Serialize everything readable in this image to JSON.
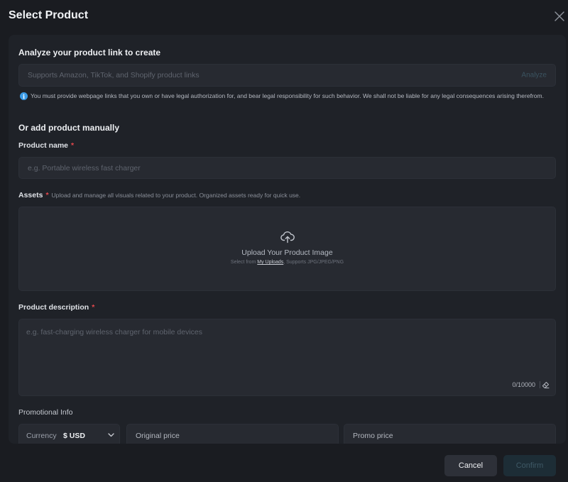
{
  "dialog": {
    "title": "Select Product"
  },
  "analyze": {
    "title": "Analyze your product link to create",
    "placeholder": "Supports Amazon, TikTok, and Shopify product links",
    "button_label": "Analyze",
    "notice": "You must provide webpage links that you own or have legal authorization for, and bear legal responsibility for such behavior. We shall not be liable for any legal consequences arising therefrom."
  },
  "manual": {
    "title": "Or add product manually",
    "required_mark": "*",
    "product_name": {
      "label": "Product name",
      "placeholder": "e.g. Portable wireless fast charger"
    },
    "assets": {
      "label": "Assets",
      "hint": "Upload and manage all visuals related to your product. Organized assets ready for quick use.",
      "upload_title": "Upload Your Product Image",
      "upload_sub_prefix": "Select from",
      "upload_sub_link": "My Uploads",
      "upload_sub_suffix": ", Supports JPG/JPEG/PNG"
    },
    "description": {
      "label": "Product description",
      "placeholder": "e.g. fast-charging wireless charger for mobile devices",
      "char_count": "0/10000"
    }
  },
  "promo": {
    "label": "Promotional Info",
    "currency_label": "Currency",
    "currency_value": "$ USD",
    "original_price_placeholder": "Original price",
    "promo_price_placeholder": "Promo price"
  },
  "footer": {
    "cancel_label": "Cancel",
    "confirm_label": "Confirm"
  },
  "colors": {
    "background": "#1a1c21",
    "panel": "#1f2228",
    "field": "#272a31",
    "required": "#e5484d",
    "info": "#3b9be6"
  },
  "icons": [
    "close-icon",
    "info-icon",
    "cloud-upload-icon",
    "eraser-icon",
    "chevron-down-icon"
  ]
}
